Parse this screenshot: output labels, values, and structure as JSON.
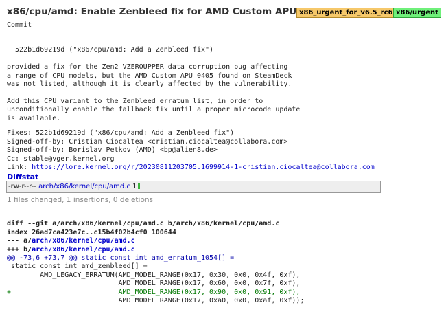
{
  "header": {
    "title": "x86/cpu/amd: Enable Zenbleed fix for AMD Custom APU 0405",
    "badges": [
      {
        "label": "x86_urgent_for_v6.5_rc6",
        "color": "#f6c86a"
      },
      {
        "label": "x86/urgent",
        "color": "#6ff07a"
      }
    ]
  },
  "commit": {
    "label": "Commit",
    "message_lines": [
      "",
      "  522b1d69219d (\"x86/cpu/amd: Add a Zenbleed fix\")",
      "",
      "provided a fix for the Zen2 VZEROUPPER data corruption bug affecting",
      "a range of CPU models, but the AMD Custom APU 0405 found on SteamDeck",
      "was not listed, although it is clearly affected by the vulnerability.",
      "",
      "Add this CPU variant to the Zenbleed erratum list, in order to",
      "unconditionally enable the fallback fix until a proper microcode update",
      "is available.",
      ""
    ],
    "trailers": [
      "Fixes: 522b1d69219d (\"x86/cpu/amd: Add a Zenbleed fix\")",
      "Signed-off-by: Cristian Ciocaltea <cristian.ciocaltea@collabora.com>",
      "Signed-off-by: Borislav Petkov (AMD) <bp@alien8.de>",
      "Cc: stable@vger.kernel.org"
    ],
    "link_prefix": "Link: ",
    "link_url": "https://lore.kernel.org/r/20230811203705.1699914-1-cristian.ciocaltea@collabora.com"
  },
  "diffstat": {
    "title": "Diffstat",
    "mode": "-rw-r--r--",
    "file": "arch/x86/kernel/cpu/amd.c",
    "count": "1",
    "bar_color": "#3cb43c",
    "summary": "1 files changed, 1 insertions, 0 deletions"
  },
  "diff": {
    "git_line": "diff --git a/arch/x86/kernel/cpu/amd.c b/arch/x86/kernel/cpu/amd.c",
    "index_line": "index 26ad7ca423e7c..c15b4f02b4cf0 100644",
    "minus_prefix": "--- a/",
    "minus_path": "arch/x86/kernel/cpu/amd.c",
    "plus_prefix": "+++ b/",
    "plus_path": "arch/x86/kernel/cpu/amd.c",
    "hunk": "@@ -73,6 +73,7 @@ static const int amd_erratum_1054[] =",
    "context1": " static const int amd_zenbleed[] =",
    "context2": "        AMD_LEGACY_ERRATUM(AMD_MODEL_RANGE(0x17, 0x30, 0x0, 0x4f, 0xf),",
    "context3": "                           AMD_MODEL_RANGE(0x17, 0x60, 0x0, 0x7f, 0xf),",
    "added": "+                          AMD_MODEL_RANGE(0x17, 0x90, 0x0, 0x91, 0xf),",
    "context4": "                           AMD_MODEL_RANGE(0x17, 0xa0, 0x0, 0xaf, 0xf));"
  }
}
